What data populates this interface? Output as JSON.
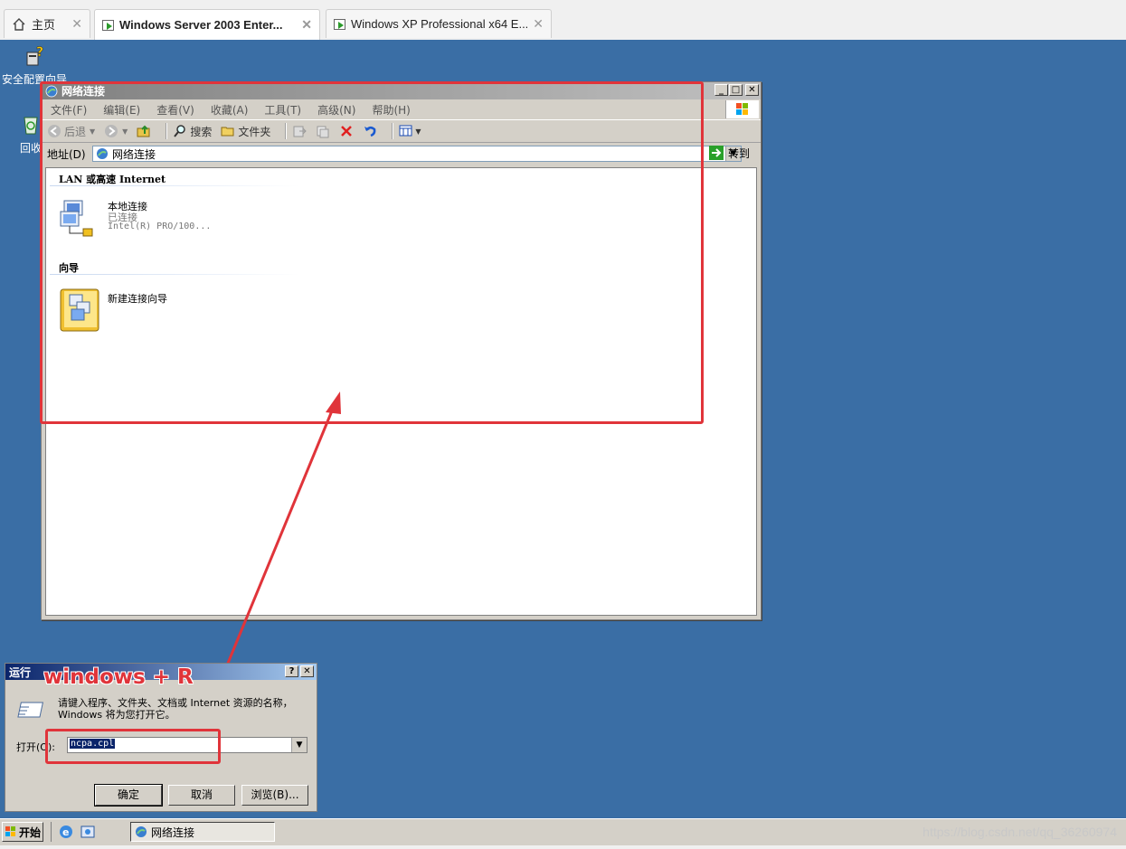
{
  "vmware_tabs": [
    {
      "label": "主页",
      "close": "✕"
    },
    {
      "label": "Windows Server 2003 Enter...",
      "close": "✕"
    },
    {
      "label": "Windows XP Professional x64 E...",
      "close": "✕"
    }
  ],
  "desktop_icons": [
    {
      "label": "安全配置向导"
    },
    {
      "label": "回收"
    }
  ],
  "explorer": {
    "title": "网络连接",
    "menu": [
      "文件(F)",
      "编辑(E)",
      "查看(V)",
      "收藏(A)",
      "工具(T)",
      "高级(N)",
      "帮助(H)"
    ],
    "toolbar": {
      "back": "后退",
      "search": "搜索",
      "folders": "文件夹"
    },
    "address_label": "地址(D)",
    "address_value": "网络连接",
    "go_label": "转到",
    "groups": [
      {
        "title": "LAN 或高速 Internet"
      },
      {
        "title": "向导"
      }
    ],
    "items": [
      {
        "name": "本地连接",
        "status": "已连接",
        "device": "Intel(R) PRO/100..."
      },
      {
        "name": "新建连接向导"
      }
    ]
  },
  "run_dialog": {
    "title": "运行",
    "help": "?",
    "close": "✕",
    "description": "请键入程序、文件夹、文档或 Internet 资源的名称，Windows 将为您打开它。",
    "open_label": "打开(O):",
    "open_value": "ncpa.cpl",
    "ok": "确定",
    "cancel": "取消",
    "browse": "浏览(B)..."
  },
  "annotation": "windows + R",
  "taskbar": {
    "start": "开始",
    "task": "网络连接"
  },
  "watermark": "https://blog.csdn.net/qq_36260974",
  "colors": {
    "desktop": "#3a6ea5",
    "annotation": "#e0343a"
  }
}
